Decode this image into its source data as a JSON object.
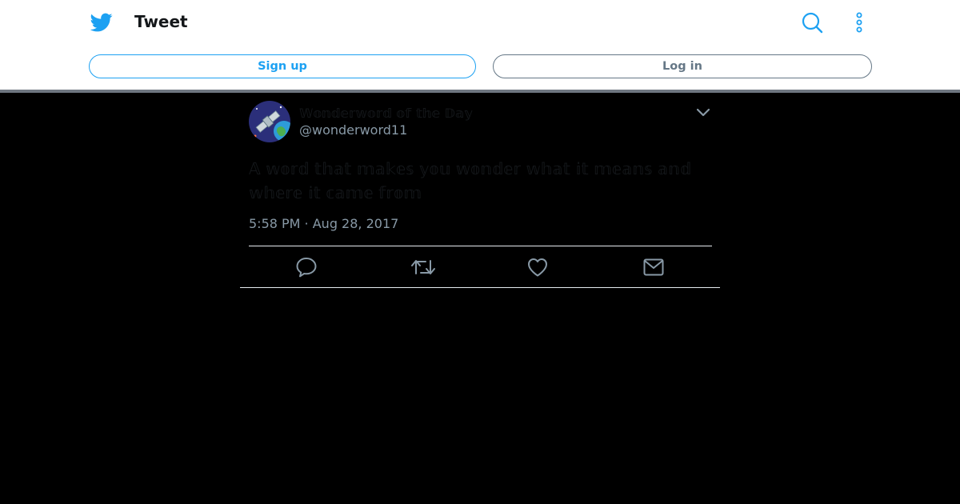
{
  "header": {
    "title": "Tweet",
    "logo_icon": "twitter-bird-icon",
    "search_icon": "search-icon",
    "more_icon": "more-vertical-icon",
    "accent_color": "#1da1f2"
  },
  "auth": {
    "signup_label": "Sign up",
    "login_label": "Log in"
  },
  "tweet": {
    "author": {
      "display_name": "𝕎𝕠𝕟𝕕𝕖𝕣𝕨𝕠𝕣𝕕 𝕠𝕗 𝕥𝕙𝕖 𝔻𝕒𝕪",
      "handle": "@wonderword11",
      "avatar_icon": "satellite-avatar-icon"
    },
    "text": "𝔸 𝕨𝕠𝕣𝕕 𝕥𝕙𝕒𝕥 𝕞𝕒𝕜𝕖𝕤 𝕪𝕠𝕦 𝕨𝕠𝕟𝕕𝕖𝕣 𝕨𝕙𝕒𝕥 𝕚𝕥 𝕞𝕖𝕒𝕟𝕤 𝕒𝕟𝕕 𝕨𝕙𝕖𝕣𝕖 𝕚𝕥 𝕔𝕒𝕞𝕖 𝕗𝕣𝕠𝕞",
    "timestamp": "5:58 PM · Aug 28, 2017"
  },
  "actions": {
    "reply_icon": "reply-icon",
    "retweet_icon": "retweet-icon",
    "like_icon": "heart-icon",
    "dm_icon": "envelope-icon"
  }
}
